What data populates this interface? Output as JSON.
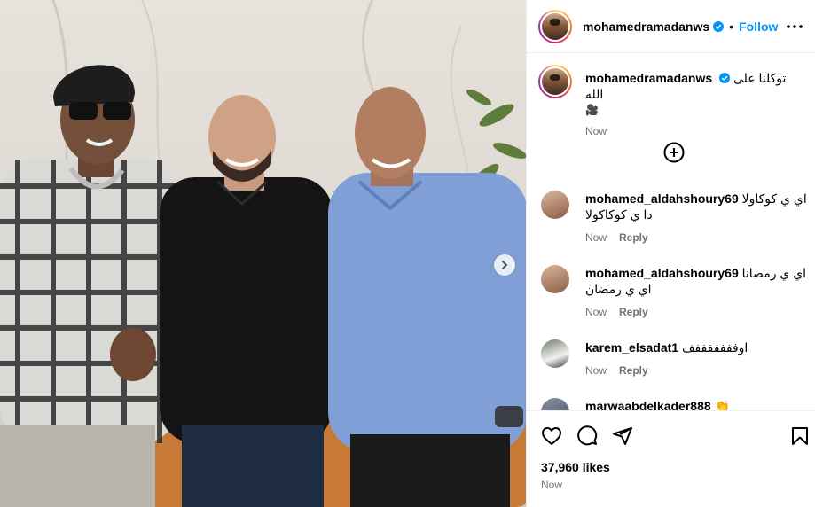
{
  "post": {
    "username": "mohamedramadanws",
    "follow_label": "Follow",
    "separator": "•",
    "caption_text": "توكلنا على الله",
    "caption_emoji": "🎥",
    "caption_time": "Now",
    "likes": "37,960 likes",
    "time": "Now"
  },
  "comments": [
    {
      "username": "mohamed_aldahshoury69",
      "text": "اي ي كوكاولا دا ي كوكاكولا",
      "time": "Now",
      "reply_label": "Reply"
    },
    {
      "username": "mohamed_aldahshoury69",
      "text": "اي ي رمضانا اي ي رمضان",
      "time": "Now",
      "reply_label": "Reply"
    },
    {
      "username": "karem_elsadat1",
      "text": "اوفففففففف",
      "time": "Now",
      "reply_label": "Reply"
    },
    {
      "username": "marwaabdelkader888",
      "text": "👏",
      "time": "",
      "reply_label": ""
    }
  ],
  "icons": {
    "verified": "verified-badge-icon",
    "more": "more-options-icon",
    "load_more": "plus-circle-icon",
    "like": "heart-icon",
    "comment": "comment-icon",
    "share": "paper-plane-icon",
    "save": "bookmark-icon",
    "next": "chevron-right-icon"
  },
  "colors": {
    "accent": "#0095f6",
    "muted": "#737373",
    "verified": "#0095f6"
  }
}
